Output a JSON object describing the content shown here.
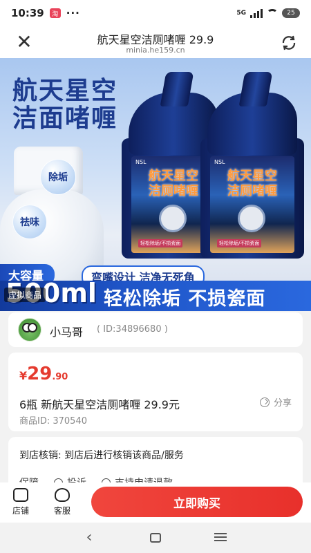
{
  "status_bar": {
    "time": "10:39",
    "app_badge": "淘",
    "dots": "···",
    "network": "5G",
    "battery": "25"
  },
  "nav": {
    "title": "航天星空洁厕啫喱 29.9",
    "url": "minia.he159.cn"
  },
  "banner": {
    "title_line1": "航天星空",
    "title_line2": "洁面啫喱",
    "bubble1": "除垢",
    "bubble2": "祛味",
    "bottle_brand": "NSL",
    "bottle_label_line1": "航天星空",
    "bottle_label_line2": "洁厕啫喱",
    "bottle_tag": "轻松除垢/不损瓷面",
    "capacity_tag": "大容量",
    "slogan1": "弯嘴设计 洁净无死角",
    "volume": "500ml",
    "virtual_tag": "虚拟商品",
    "slogan2": "轻松除垢 不损瓷面"
  },
  "seller": {
    "name": "小马哥",
    "id_text": "( ID:34896680 )"
  },
  "product": {
    "price_symbol": "¥",
    "price_int": "29",
    "price_dec": ".90",
    "title": "6瓶 新航天星空洁厕啫喱 29.9元",
    "share_label": "分享",
    "id_text": "商品ID: 370540"
  },
  "service": {
    "line": "到店核销: 到店后进行核销该商品/服务",
    "guarantee_label": "保障",
    "complaint_label": "投诉",
    "refund_label": "支持申请退款"
  },
  "bottom_bar": {
    "shop_label": "店铺",
    "service_label": "客服",
    "buy_label": "立即购买"
  },
  "colors": {
    "accent": "#e8302b",
    "price": "#e53b2f",
    "banner_blue": "#1d3c8f"
  }
}
